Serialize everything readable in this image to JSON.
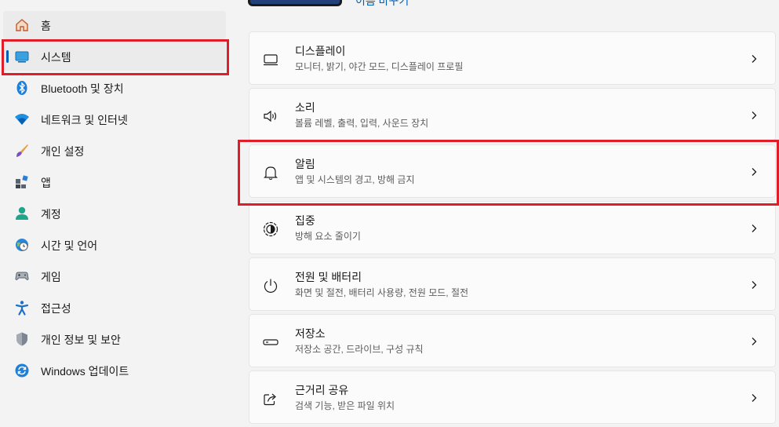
{
  "sidebar": {
    "items": [
      {
        "label": "홈",
        "icon": "home-icon"
      },
      {
        "label": "시스템",
        "icon": "system-icon"
      },
      {
        "label": "Bluetooth 및 장치",
        "icon": "bluetooth-icon"
      },
      {
        "label": "네트워크 및 인터넷",
        "icon": "wifi-icon"
      },
      {
        "label": "개인 설정",
        "icon": "brush-icon"
      },
      {
        "label": "앱",
        "icon": "apps-icon"
      },
      {
        "label": "계정",
        "icon": "account-icon"
      },
      {
        "label": "시간 및 언어",
        "icon": "globe-clock-icon"
      },
      {
        "label": "게임",
        "icon": "gamepad-icon"
      },
      {
        "label": "접근성",
        "icon": "accessibility-icon"
      },
      {
        "label": "개인 정보 및 보안",
        "icon": "shield-icon"
      },
      {
        "label": "Windows 업데이트",
        "icon": "update-icon"
      }
    ]
  },
  "top": {
    "link": "이름 바꾸기"
  },
  "cards": [
    {
      "title": "디스플레이",
      "subtitle": "모니터, 밝기, 야간 모드, 디스플레이 프로필",
      "icon": "display-icon"
    },
    {
      "title": "소리",
      "subtitle": "볼륨 레벨, 출력, 입력, 사운드 장치",
      "icon": "speaker-icon"
    },
    {
      "title": "알림",
      "subtitle": "앱 및 시스템의 경고, 방해 금지",
      "icon": "bell-icon"
    },
    {
      "title": "집중",
      "subtitle": "방해 요소 줄이기",
      "icon": "focus-icon"
    },
    {
      "title": "전원 및 배터리",
      "subtitle": "화면 및 절전, 배터리 사용량, 전원 모드, 절전",
      "icon": "power-icon"
    },
    {
      "title": "저장소",
      "subtitle": "저장소 공간, 드라이브, 구성 규칙",
      "icon": "storage-icon"
    },
    {
      "title": "근거리 공유",
      "subtitle": "검색 기능, 받은 파일 위치",
      "icon": "share-icon"
    }
  ],
  "colors": {
    "accent": "#005fb8",
    "highlight": "#e01d29",
    "background": "#f3f3f3",
    "card": "#fbfbfb"
  }
}
